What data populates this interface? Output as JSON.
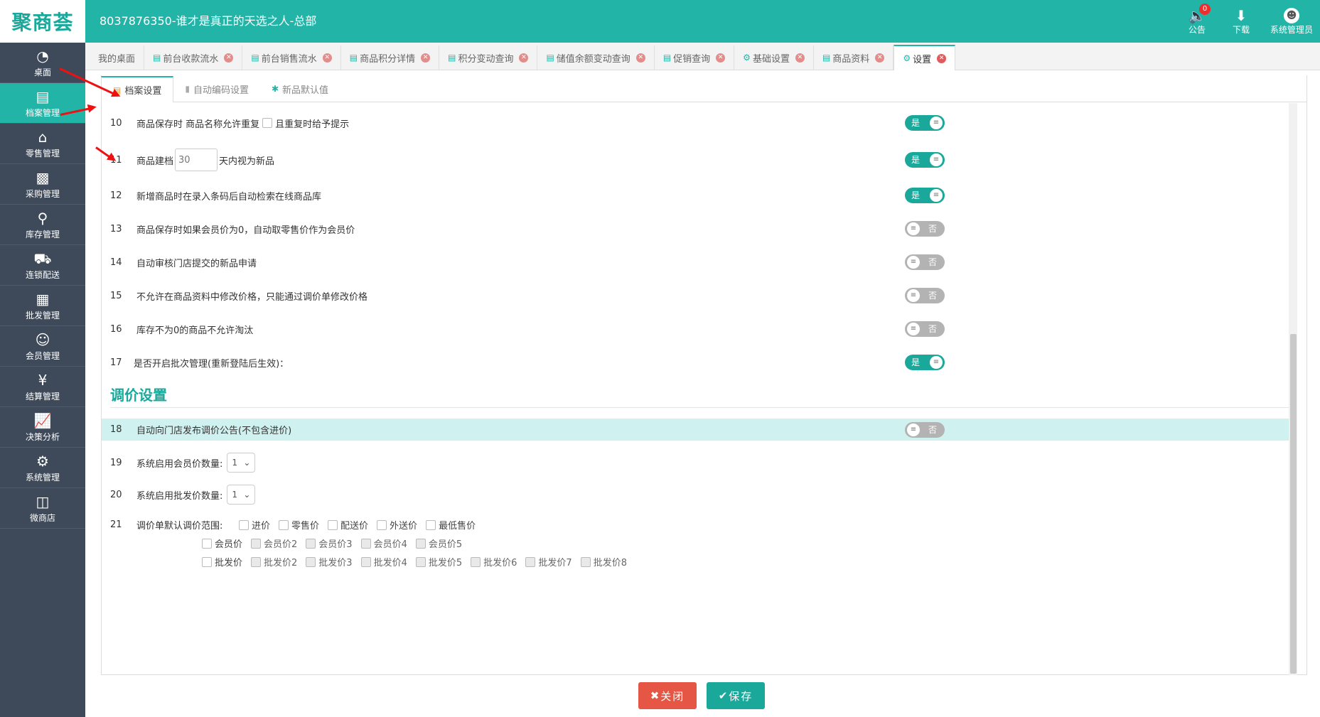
{
  "header": {
    "logo": "聚商荟",
    "title": "8037876350-谁才是真正的天选之人-总部",
    "actions": [
      {
        "label": "公告",
        "icon": "speaker-icon",
        "badge": "0"
      },
      {
        "label": "下载",
        "icon": "download-icon"
      },
      {
        "label": "系统管理员",
        "icon": "avatar-icon"
      }
    ]
  },
  "sidebar": {
    "items": [
      {
        "label": "桌面",
        "icon": "dashboard-icon"
      },
      {
        "label": "档案管理",
        "icon": "archive-icon"
      },
      {
        "label": "零售管理",
        "icon": "store-icon"
      },
      {
        "label": "采购管理",
        "icon": "cart-icon"
      },
      {
        "label": "库存管理",
        "icon": "inventory-search-icon"
      },
      {
        "label": "连锁配送",
        "icon": "truck-icon"
      },
      {
        "label": "批发管理",
        "icon": "wholesale-icon"
      },
      {
        "label": "会员管理",
        "icon": "member-icon"
      },
      {
        "label": "结算管理",
        "icon": "settlement-icon"
      },
      {
        "label": "决策分析",
        "icon": "chart-icon"
      },
      {
        "label": "系统管理",
        "icon": "gear-icon"
      },
      {
        "label": "微商店",
        "icon": "shop-bag-icon"
      }
    ],
    "active_index": 1
  },
  "tabs": [
    {
      "label": "我的桌面",
      "closable": false
    },
    {
      "label": "前台收款流水",
      "closable": true
    },
    {
      "label": "前台销售流水",
      "closable": true
    },
    {
      "label": "商品积分详情",
      "closable": true
    },
    {
      "label": "积分变动查询",
      "closable": true
    },
    {
      "label": "储值余额变动查询",
      "closable": true
    },
    {
      "label": "促销查询",
      "closable": true
    },
    {
      "label": "基础设置",
      "closable": true
    },
    {
      "label": "商品资料",
      "closable": true
    },
    {
      "label": "设置",
      "closable": true
    }
  ],
  "subtabs": [
    {
      "label": "档案设置"
    },
    {
      "label": "自动编码设置"
    },
    {
      "label": "新品默认值"
    }
  ],
  "settings": {
    "r10": {
      "num": "10",
      "text_a": "商品保存时 商品名称允许重复",
      "text_b": "且重复时给予提示",
      "toggle": "是"
    },
    "r11": {
      "num": "11",
      "text_a": "商品建档",
      "value": "30",
      "text_b": "天内视为新品",
      "toggle": "是"
    },
    "r12": {
      "num": "12",
      "text": "新增商品时在录入条码后自动检索在线商品库",
      "toggle": "是"
    },
    "r13": {
      "num": "13",
      "text": "商品保存时如果会员价为0，自动取零售价作为会员价",
      "toggle": "否"
    },
    "r14": {
      "num": "14",
      "text": "自动审核门店提交的新品申请",
      "toggle": "否"
    },
    "r15": {
      "num": "15",
      "text": "不允许在商品资料中修改价格，只能通过调价单修改价格",
      "toggle": "否"
    },
    "r16": {
      "num": "16",
      "text": "库存不为0的商品不允许淘汰",
      "toggle": "否"
    },
    "r17": {
      "num": "17",
      "text": "是否开启批次管理(重新登陆后生效)：",
      "toggle": "是"
    }
  },
  "price_section": {
    "title": "调价设置",
    "r18": {
      "num": "18",
      "text": "自动向门店发布调价公告(不包含进价)",
      "toggle": "否"
    },
    "r19": {
      "num": "19",
      "text": "系统启用会员价数量:",
      "selected": "1"
    },
    "r20": {
      "num": "20",
      "text": "系统启用批发价数量:",
      "selected": "1"
    },
    "r21": {
      "num": "21",
      "text": "调价单默认调价范围:",
      "line1": [
        "进价",
        "零售价",
        "配送价",
        "外送价",
        "最低售价"
      ],
      "line2": [
        "会员价",
        "会员价2",
        "会员价3",
        "会员价4",
        "会员价5"
      ],
      "line3": [
        "批发价",
        "批发价2",
        "批发价3",
        "批发价4",
        "批发价5",
        "批发价6",
        "批发价7",
        "批发价8"
      ]
    }
  },
  "footer": {
    "close_label": "关闭",
    "save_label": "保存"
  },
  "colors": {
    "accent": "#22b5a7",
    "sidebar_bg": "#3e4a5a",
    "danger": "#e55645",
    "highlight_row": "#cff1ef"
  }
}
